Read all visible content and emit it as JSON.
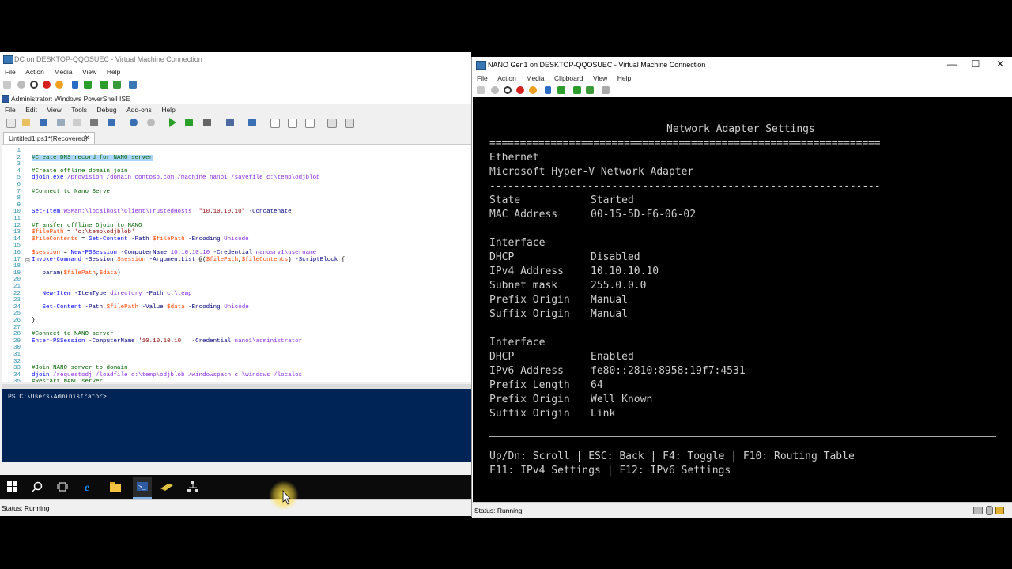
{
  "dc": {
    "title": "DC on DESKTOP-QQOSUEC - Virtual Machine Connection",
    "menu": [
      "File",
      "Action",
      "Media",
      "View",
      "Help"
    ],
    "status": "Status: Running"
  },
  "ise": {
    "title": "Administrator: Windows PowerShell ISE",
    "menu": [
      "File",
      "Edit",
      "View",
      "Tools",
      "Debug",
      "Add-ons",
      "Help"
    ],
    "tab_label": "Untitled1.ps1*(Recovered)",
    "tab_close": "✕",
    "console_prompt": "PS C:\\Users\\Administrator>",
    "code_lines": [
      {
        "n": "1",
        "html": ""
      },
      {
        "n": "2",
        "html": "<span class=\"c-com sel\">#Create DNS record for NANO server</span>"
      },
      {
        "n": "3",
        "html": ""
      },
      {
        "n": "4",
        "html": "<span class=\"c-com\">#Create offline domain join</span>"
      },
      {
        "n": "5",
        "html": "<span class=\"c-cmd\">djoin.exe</span> <span class=\"c-arg\">/provision /domain contoso.com /machine nano1 /savefile c:\\temp\\odjblob</span>"
      },
      {
        "n": "6",
        "html": ""
      },
      {
        "n": "7",
        "html": "<span class=\"c-com\">#Connect to Nano Server</span>"
      },
      {
        "n": "8",
        "html": ""
      },
      {
        "n": "9",
        "html": ""
      },
      {
        "n": "10",
        "html": "<span class=\"c-cmd\">Set-Item</span> <span class=\"c-arg\">WSMan:\\localhost\\Client\\TrustedHosts</span>  <span class=\"c-str\">\"10.10.10.10\"</span> <span class=\"c-par\">-Concatenate</span>"
      },
      {
        "n": "11",
        "html": ""
      },
      {
        "n": "12",
        "html": "<span class=\"c-com\">#Transfer offline Djoin to NANO</span>"
      },
      {
        "n": "13",
        "html": "<span class=\"c-var\">$filePath</span> = <span class=\"c-str\">'c:\\temp\\odjblob'</span>"
      },
      {
        "n": "14",
        "html": "<span class=\"c-var\">$fileContents</span> = <span class=\"c-cmd\">Get-Content</span> <span class=\"c-par\">-Path</span> <span class=\"c-var\">$filePath</span> <span class=\"c-par\">-Encoding</span> <span class=\"c-arg\">Unicode</span>"
      },
      {
        "n": "15",
        "html": ""
      },
      {
        "n": "16",
        "html": "<span class=\"c-var\">$session</span> = <span class=\"c-cmd\">New-PSSession</span> <span class=\"c-par\">-ComputerName</span> <span class=\"c-arg\">10.10.10.10</span> <span class=\"c-par\">-Credential</span> <span class=\"c-arg\">nanosrv1\\username</span>"
      },
      {
        "n": "17",
        "html": "<span class=\"c-cmd\">Invoke-Command</span> <span class=\"c-par\">-Session</span> <span class=\"c-var\">$session</span> <span class=\"c-par\">-ArgumentList</span> @(<span class=\"c-var\">$filePath</span>,<span class=\"c-var\">$fileContents</span>) <span class=\"c-par\">-ScriptBlock</span> {"
      },
      {
        "n": "18",
        "html": ""
      },
      {
        "n": "19",
        "html": "   <span class=\"c-par\">param</span>(<span class=\"c-var\">$filePath</span>,<span class=\"c-var\">$data</span>)"
      },
      {
        "n": "20",
        "html": ""
      },
      {
        "n": "21",
        "html": ""
      },
      {
        "n": "22",
        "html": "   <span class=\"c-cmd\">New-Item</span> <span class=\"c-par\">-ItemType</span> <span class=\"c-arg\">directory</span> <span class=\"c-par\">-Path</span> <span class=\"c-arg\">c:\\temp</span>"
      },
      {
        "n": "23",
        "html": ""
      },
      {
        "n": "24",
        "html": "   <span class=\"c-cmd\">Set-Content</span> <span class=\"c-par\">-Path</span> <span class=\"c-var\">$filePath</span> <span class=\"c-par\">-Value</span> <span class=\"c-var\">$data</span> <span class=\"c-par\">-Encoding</span> <span class=\"c-arg\">Unicode</span>"
      },
      {
        "n": "25",
        "html": ""
      },
      {
        "n": "26",
        "html": "}"
      },
      {
        "n": "27",
        "html": ""
      },
      {
        "n": "28",
        "html": "<span class=\"c-com\">#Connect to NANO server</span>"
      },
      {
        "n": "29",
        "html": "<span class=\"c-cmd\">Enter-PSSession</span> <span class=\"c-par\">-ComputerName</span> <span class=\"c-str\">'10.10.10.10'</span>  <span class=\"c-par\">-Credential</span> <span class=\"c-arg\">nano1\\administrator</span>"
      },
      {
        "n": "30",
        "html": ""
      },
      {
        "n": "31",
        "html": ""
      },
      {
        "n": "32",
        "html": ""
      },
      {
        "n": "33",
        "html": "<span class=\"c-com\">#Join NANO server to domain</span>"
      },
      {
        "n": "34",
        "html": "<span class=\"c-cmd\">djoin</span> <span class=\"c-arg\">/requestodj /loadfile c:\\temp\\odjblob /windowspath c:\\windows /localos</span>"
      },
      {
        "n": "35",
        "html": "<span class=\"c-com\">#Restart NANO server</span>"
      }
    ]
  },
  "taskbar": {
    "icons": [
      "windows-start-icon",
      "search-icon",
      "task-view-icon",
      "internet-explorer-icon",
      "file-explorer-icon",
      "powershell-ise-icon",
      "tools-icon",
      "network-icon"
    ]
  },
  "nano": {
    "title": "NANO Gen1 on DESKTOP-QQOSUEC - Virtual Machine Connection",
    "menu": [
      "File",
      "Action",
      "Media",
      "Clipboard",
      "View",
      "Help"
    ],
    "controls": {
      "minimize": "—",
      "maximize": "☐",
      "close": "✕"
    },
    "status": "Status: Running",
    "screen": {
      "heading": "Network Adapter Settings",
      "double_rule": "================================================================",
      "adapter_name": "Ethernet",
      "adapter_desc": "Microsoft Hyper-V Network Adapter",
      "dash_rule": "----------------------------------------------------------------",
      "rows": [
        {
          "label": "State",
          "value": "Started"
        },
        {
          "label": "MAC Address",
          "value": "00-15-5D-F6-06-02"
        },
        {
          "label": "",
          "value": ""
        },
        {
          "label": "Interface",
          "value": ""
        },
        {
          "label": "DHCP",
          "value": "Disabled"
        },
        {
          "label": "IPv4 Address",
          "value": "10.10.10.10"
        },
        {
          "label": "Subnet mask",
          "value": "255.0.0.0"
        },
        {
          "label": "Prefix Origin",
          "value": "Manual"
        },
        {
          "label": "Suffix Origin",
          "value": "Manual"
        },
        {
          "label": "",
          "value": ""
        },
        {
          "label": "Interface",
          "value": ""
        },
        {
          "label": "DHCP",
          "value": "Enabled"
        },
        {
          "label": "IPv6 Address",
          "value": "fe80::2810:8958:19f7:4531"
        },
        {
          "label": "Prefix Length",
          "value": "64"
        },
        {
          "label": "Prefix Origin",
          "value": "Well Known"
        },
        {
          "label": "Suffix Origin",
          "value": "Link"
        }
      ],
      "help_line1": "Up/Dn: Scroll | ESC: Back | F4: Toggle | F10: Routing Table",
      "help_line2": "F11: IPv4 Settings | F12: IPv6 Settings"
    }
  }
}
